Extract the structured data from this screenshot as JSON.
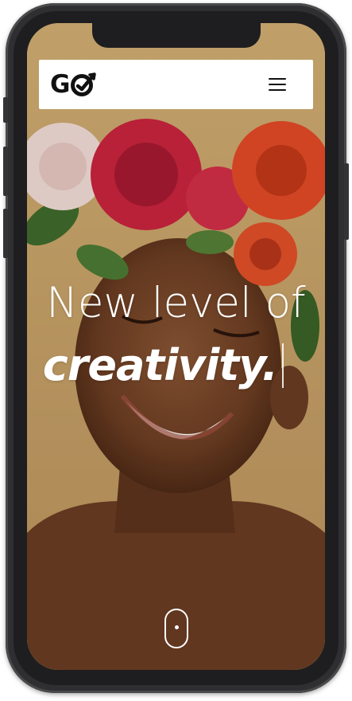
{
  "navbar": {
    "logo": {
      "text": "G",
      "o_icon": "target-check-icon"
    },
    "menu_icon": "hamburger-menu-icon"
  },
  "hero": {
    "line1": "New level of",
    "line2": "creativity.",
    "background": "portrait-flower-crown-photo"
  },
  "scroll_indicator": {
    "icon": "mouse-scroll-icon"
  },
  "colors": {
    "background": "#c9a56a",
    "navbar_bg": "#ffffff",
    "text_dark": "#111111",
    "hero_text": "#ffffff",
    "phone_frame": "#2f2f31"
  }
}
